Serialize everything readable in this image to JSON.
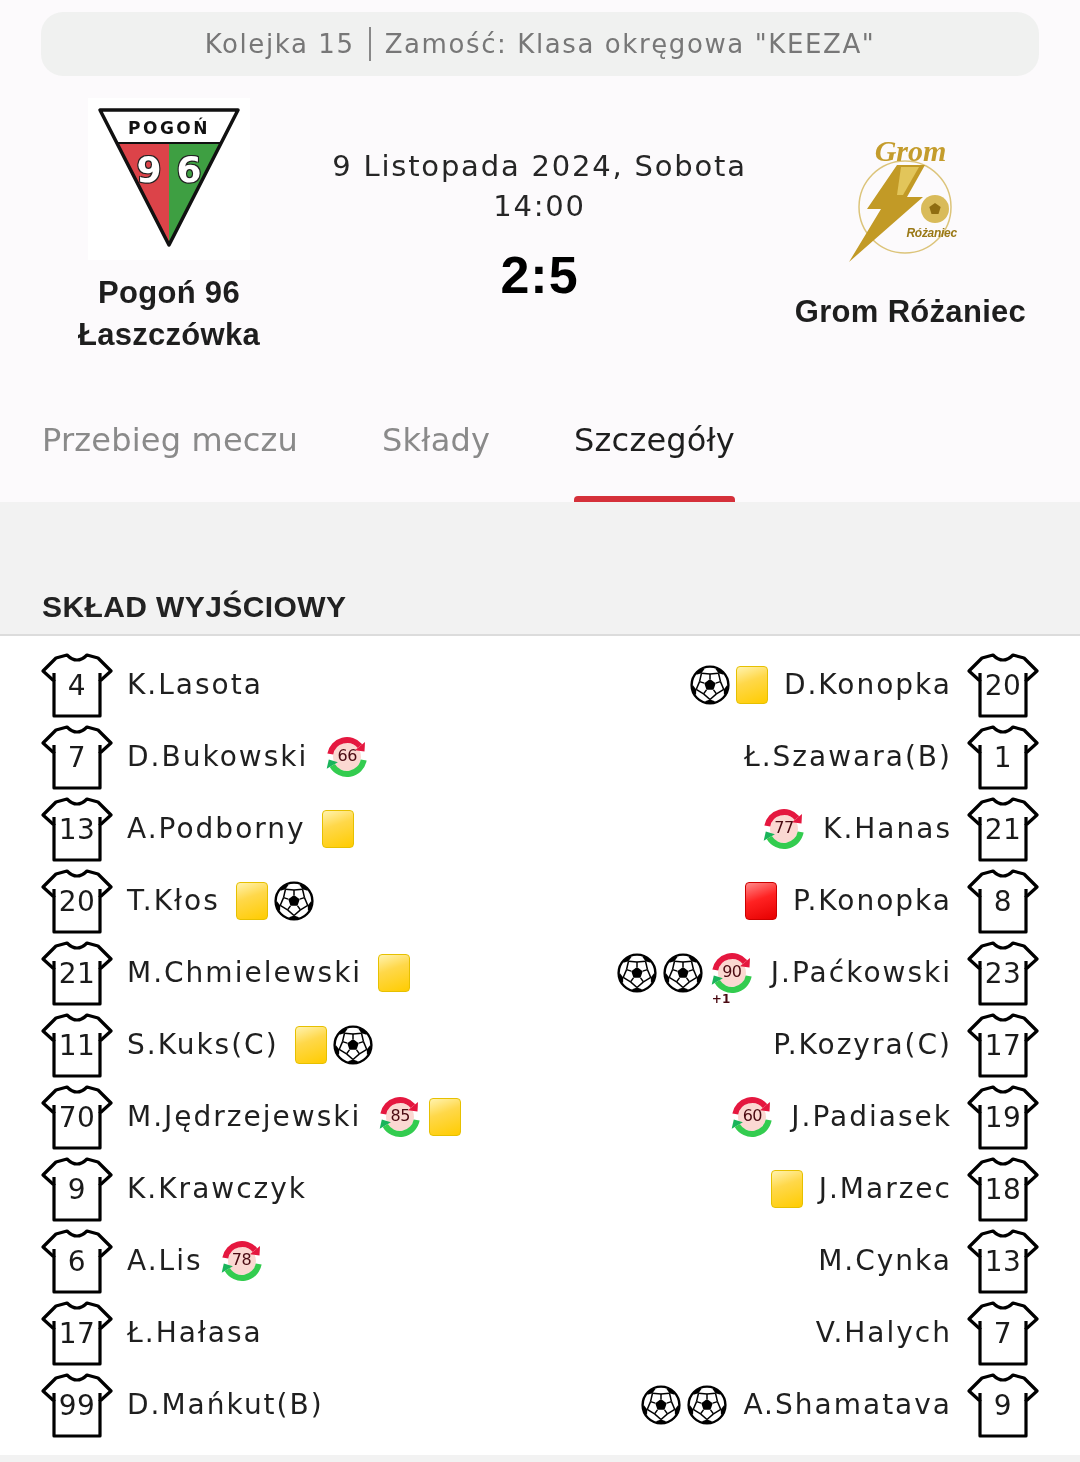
{
  "header": {
    "round": "Kolejka 15",
    "league": "Zamość: Klasa okręgowa \"KEEZA\""
  },
  "match": {
    "home": {
      "name": "Pogoń 96 Łaszczówka",
      "logo": {
        "kind": "shield",
        "banner": "POGOŃ",
        "number": "96"
      }
    },
    "date": "9 Listopada 2024, Sobota",
    "time": "14:00",
    "score": "2:5",
    "away": {
      "name": "Grom Różaniec",
      "logo": {
        "kind": "emblem",
        "wordmark": "Grom",
        "town": "Różaniec"
      }
    }
  },
  "tabs": [
    {
      "label": "Przebieg meczu",
      "selected": false
    },
    {
      "label": "Składy",
      "selected": false
    },
    {
      "label": "Szczegóły",
      "selected": true
    }
  ],
  "lineup": {
    "title": "SKŁAD WYJŚCIOWY",
    "home": [
      {
        "number": "4",
        "name": "K.Lasota"
      },
      {
        "number": "7",
        "name": "D.Bukowski",
        "events": [
          {
            "kind": "substitution",
            "minute": "66"
          }
        ]
      },
      {
        "number": "13",
        "name": "A.Podborny",
        "events": [
          {
            "kind": "yellow_card"
          }
        ]
      },
      {
        "number": "20",
        "name": "T.Kłos",
        "events": [
          {
            "kind": "yellow_card"
          },
          {
            "kind": "goal"
          }
        ]
      },
      {
        "number": "21",
        "name": "M.Chmielewski",
        "events": [
          {
            "kind": "yellow_card"
          }
        ]
      },
      {
        "number": "11",
        "name": "S.Kuks(C)",
        "events": [
          {
            "kind": "yellow_card"
          },
          {
            "kind": "goal"
          }
        ]
      },
      {
        "number": "70",
        "name": "M.Jędrzejewski",
        "events": [
          {
            "kind": "substitution",
            "minute": "85"
          },
          {
            "kind": "yellow_card"
          }
        ]
      },
      {
        "number": "9",
        "name": "K.Krawczyk"
      },
      {
        "number": "6",
        "name": "A.Lis",
        "events": [
          {
            "kind": "substitution",
            "minute": "78"
          }
        ]
      },
      {
        "number": "17",
        "name": "Ł.Hałasa"
      },
      {
        "number": "99",
        "name": "D.Mańkut(B)"
      }
    ],
    "away": [
      {
        "number": "20",
        "name": "D.Konopka",
        "events": [
          {
            "kind": "goal"
          },
          {
            "kind": "yellow_card"
          }
        ]
      },
      {
        "number": "1",
        "name": "Ł.Szawara(B)"
      },
      {
        "number": "21",
        "name": "K.Hanas",
        "events": [
          {
            "kind": "substitution",
            "minute": "77"
          }
        ]
      },
      {
        "number": "8",
        "name": "P.Konopka",
        "events": [
          {
            "kind": "red_card"
          }
        ]
      },
      {
        "number": "23",
        "name": "J.Paćkowski",
        "events": [
          {
            "kind": "goal"
          },
          {
            "kind": "goal"
          },
          {
            "kind": "substitution",
            "minute": "90",
            "extra": "+1"
          }
        ]
      },
      {
        "number": "17",
        "name": "P.Kozyra(C)"
      },
      {
        "number": "19",
        "name": "J.Padiasek",
        "events": [
          {
            "kind": "substitution",
            "minute": "60"
          }
        ]
      },
      {
        "number": "18",
        "name": "J.Marzec",
        "events": [
          {
            "kind": "yellow_card"
          }
        ]
      },
      {
        "number": "13",
        "name": "M.Cynka"
      },
      {
        "number": "7",
        "name": "V.Halych"
      },
      {
        "number": "9",
        "name": "A.Shamatava",
        "events": [
          {
            "kind": "goal"
          },
          {
            "kind": "goal"
          }
        ]
      }
    ]
  }
}
